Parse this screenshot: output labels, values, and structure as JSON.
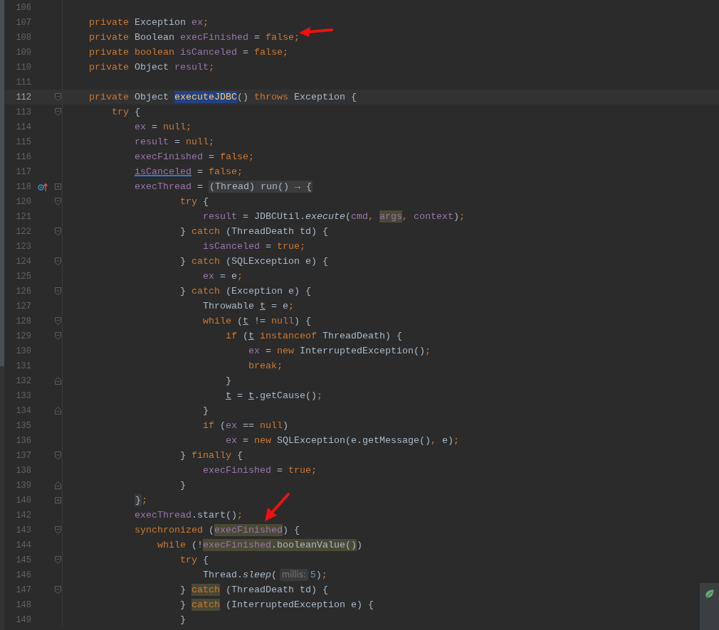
{
  "editor": {
    "lines": [
      {
        "number": "106",
        "current": false
      },
      {
        "number": "107",
        "current": false,
        "tokens": [
          {
            "kind": "keyword",
            "text": "    private "
          },
          {
            "kind": "plain",
            "text": "Exception "
          },
          {
            "kind": "field",
            "text": "ex"
          },
          {
            "kind": "keyword",
            "text": ";"
          }
        ]
      },
      {
        "number": "108",
        "current": false,
        "tokens": [
          {
            "kind": "keyword",
            "text": "    private "
          },
          {
            "kind": "plain",
            "text": "Boolean "
          },
          {
            "kind": "field",
            "text": "execFinished"
          },
          {
            "kind": "plain",
            "text": " = "
          },
          {
            "kind": "keyword",
            "text": "false;"
          }
        ]
      },
      {
        "number": "109",
        "current": false,
        "tokens": [
          {
            "kind": "keyword",
            "text": "    private boolean "
          },
          {
            "kind": "field",
            "text": "isCanceled"
          },
          {
            "kind": "plain",
            "text": " = "
          },
          {
            "kind": "keyword",
            "text": "false;"
          }
        ]
      },
      {
        "number": "110",
        "current": false,
        "tokens": [
          {
            "kind": "keyword",
            "text": "    private "
          },
          {
            "kind": "plain",
            "text": "Object "
          },
          {
            "kind": "field",
            "text": "result"
          },
          {
            "kind": "keyword",
            "text": ";"
          }
        ]
      },
      {
        "number": "111",
        "current": false
      },
      {
        "number": "112",
        "current": true,
        "fold": {
          "kind": "start"
        },
        "tokens": [
          {
            "kind": "keyword",
            "text": "    private "
          },
          {
            "kind": "plain",
            "text": "Object "
          },
          {
            "kind": "declaration",
            "text": "executeJDBC",
            "highlight": {
              "kind": "selected"
            }
          },
          {
            "kind": "plain",
            "text": "() "
          },
          {
            "kind": "keyword",
            "text": "throws "
          },
          {
            "kind": "plain",
            "text": "Exception {"
          }
        ]
      },
      {
        "number": "113",
        "current": false,
        "fold": {
          "kind": "start"
        },
        "tokens": [
          {
            "kind": "keyword",
            "text": "        try "
          },
          {
            "kind": "plain",
            "text": "{"
          }
        ]
      },
      {
        "number": "114",
        "current": false,
        "tokens": [
          {
            "kind": "field",
            "text": "            ex"
          },
          {
            "kind": "plain",
            "text": " = "
          },
          {
            "kind": "keyword",
            "text": "null;"
          }
        ]
      },
      {
        "number": "115",
        "current": false,
        "tokens": [
          {
            "kind": "field",
            "text": "            result"
          },
          {
            "kind": "plain",
            "text": " = "
          },
          {
            "kind": "keyword",
            "text": "null;"
          }
        ]
      },
      {
        "number": "116",
        "current": false,
        "tokens": [
          {
            "kind": "field",
            "text": "            execFinished"
          },
          {
            "kind": "plain",
            "text": " = "
          },
          {
            "kind": "keyword",
            "text": "false;"
          }
        ]
      },
      {
        "number": "117",
        "current": false,
        "tokens": [
          {
            "kind": "field",
            "text": "            isCanceled",
            "highlight": {
              "kind": "link"
            }
          },
          {
            "kind": "plain",
            "text": " = "
          },
          {
            "kind": "keyword",
            "text": "false;"
          }
        ]
      },
      {
        "number": "118",
        "current": false,
        "fold": {
          "kind": "plus"
        },
        "gutter_icon": {
          "kind": "override"
        },
        "tokens": [
          {
            "kind": "field",
            "text": "            execThread"
          },
          {
            "kind": "plain",
            "text": " = "
          },
          {
            "kind": "folded",
            "text": "(Thread) run() → {"
          }
        ]
      },
      {
        "number": "120",
        "current": false,
        "fold": {
          "kind": "start"
        },
        "tokens": [
          {
            "kind": "keyword",
            "text": "                    try "
          },
          {
            "kind": "plain",
            "text": "{"
          }
        ]
      },
      {
        "number": "121",
        "current": false,
        "tokens": [
          {
            "kind": "field",
            "text": "                        result"
          },
          {
            "kind": "plain",
            "text": " = JDBCUtil."
          },
          {
            "kind": "method",
            "text": "execute"
          },
          {
            "kind": "plain",
            "text": "("
          },
          {
            "kind": "field",
            "text": "cmd"
          },
          {
            "kind": "keyword",
            "text": ", "
          },
          {
            "kind": "field",
            "text": "args",
            "highlight": {
              "kind": "usage"
            }
          },
          {
            "kind": "keyword",
            "text": ", "
          },
          {
            "kind": "field",
            "text": "context"
          },
          {
            "kind": "plain",
            "text": ")"
          },
          {
            "kind": "keyword",
            "text": ";"
          }
        ]
      },
      {
        "number": "122",
        "current": false,
        "fold": {
          "kind": "mid"
        },
        "tokens": [
          {
            "kind": "plain",
            "text": "                    } "
          },
          {
            "kind": "keyword",
            "text": "catch "
          },
          {
            "kind": "plain",
            "text": "(ThreadDeath td) {"
          }
        ]
      },
      {
        "number": "123",
        "current": false,
        "tokens": [
          {
            "kind": "field",
            "text": "                        isCanceled"
          },
          {
            "kind": "plain",
            "text": " = "
          },
          {
            "kind": "keyword",
            "text": "true;"
          }
        ]
      },
      {
        "number": "124",
        "current": false,
        "fold": {
          "kind": "mid"
        },
        "tokens": [
          {
            "kind": "plain",
            "text": "                    } "
          },
          {
            "kind": "keyword",
            "text": "catch "
          },
          {
            "kind": "plain",
            "text": "(SQLException e) {"
          }
        ]
      },
      {
        "number": "125",
        "current": false,
        "tokens": [
          {
            "kind": "field",
            "text": "                        ex"
          },
          {
            "kind": "plain",
            "text": " = e"
          },
          {
            "kind": "keyword",
            "text": ";"
          }
        ]
      },
      {
        "number": "126",
        "current": false,
        "fold": {
          "kind": "mid"
        },
        "tokens": [
          {
            "kind": "plain",
            "text": "                    } "
          },
          {
            "kind": "keyword",
            "text": "catch "
          },
          {
            "kind": "plain",
            "text": "(Exception e) {"
          }
        ]
      },
      {
        "number": "127",
        "current": false,
        "tokens": [
          {
            "kind": "plain",
            "text": "                        Throwable "
          },
          {
            "kind": "plain",
            "text": "t",
            "highlight": {
              "kind": "underline"
            }
          },
          {
            "kind": "plain",
            "text": " = e"
          },
          {
            "kind": "keyword",
            "text": ";"
          }
        ]
      },
      {
        "number": "128",
        "current": false,
        "fold": {
          "kind": "start"
        },
        "tokens": [
          {
            "kind": "keyword",
            "text": "                        while "
          },
          {
            "kind": "plain",
            "text": "("
          },
          {
            "kind": "plain",
            "text": "t",
            "highlight": {
              "kind": "underline"
            }
          },
          {
            "kind": "plain",
            "text": " != "
          },
          {
            "kind": "keyword",
            "text": "null"
          },
          {
            "kind": "plain",
            "text": ") {"
          }
        ]
      },
      {
        "number": "129",
        "current": false,
        "fold": {
          "kind": "start"
        },
        "tokens": [
          {
            "kind": "keyword",
            "text": "                            if "
          },
          {
            "kind": "plain",
            "text": "("
          },
          {
            "kind": "plain",
            "text": "t",
            "highlight": {
              "kind": "underline"
            }
          },
          {
            "kind": "keyword",
            "text": " instanceof "
          },
          {
            "kind": "plain",
            "text": "ThreadDeath) {"
          }
        ]
      },
      {
        "number": "130",
        "current": false,
        "tokens": [
          {
            "kind": "field",
            "text": "                                ex"
          },
          {
            "kind": "plain",
            "text": " = "
          },
          {
            "kind": "keyword",
            "text": "new "
          },
          {
            "kind": "plain",
            "text": "InterruptedException()"
          },
          {
            "kind": "keyword",
            "text": ";"
          }
        ]
      },
      {
        "number": "131",
        "current": false,
        "tokens": [
          {
            "kind": "keyword",
            "text": "                                break;"
          }
        ]
      },
      {
        "number": "132",
        "current": false,
        "fold": {
          "kind": "end"
        },
        "tokens": [
          {
            "kind": "plain",
            "text": "                            }"
          }
        ]
      },
      {
        "number": "133",
        "current": false,
        "tokens": [
          {
            "kind": "plain",
            "text": "                            t",
            "highlight": {
              "kind": "underline"
            }
          },
          {
            "kind": "plain",
            "text": " = "
          },
          {
            "kind": "plain",
            "text": "t",
            "highlight": {
              "kind": "underline"
            }
          },
          {
            "kind": "plain",
            "text": ".getCause()"
          },
          {
            "kind": "keyword",
            "text": ";"
          }
        ]
      },
      {
        "number": "134",
        "current": false,
        "fold": {
          "kind": "end"
        },
        "tokens": [
          {
            "kind": "plain",
            "text": "                        }"
          }
        ]
      },
      {
        "number": "135",
        "current": false,
        "tokens": [
          {
            "kind": "keyword",
            "text": "                        if "
          },
          {
            "kind": "plain",
            "text": "("
          },
          {
            "kind": "field",
            "text": "ex"
          },
          {
            "kind": "plain",
            "text": " == "
          },
          {
            "kind": "keyword",
            "text": "null"
          },
          {
            "kind": "plain",
            "text": ")"
          }
        ]
      },
      {
        "number": "136",
        "current": false,
        "tokens": [
          {
            "kind": "field",
            "text": "                            ex"
          },
          {
            "kind": "plain",
            "text": " = "
          },
          {
            "kind": "keyword",
            "text": "new "
          },
          {
            "kind": "plain",
            "text": "SQLException(e.getMessage()"
          },
          {
            "kind": "keyword",
            "text": ", "
          },
          {
            "kind": "plain",
            "text": "e)"
          },
          {
            "kind": "keyword",
            "text": ";"
          }
        ]
      },
      {
        "number": "137",
        "current": false,
        "fold": {
          "kind": "mid"
        },
        "tokens": [
          {
            "kind": "plain",
            "text": "                    } "
          },
          {
            "kind": "keyword",
            "text": "finally "
          },
          {
            "kind": "plain",
            "text": "{"
          }
        ]
      },
      {
        "number": "138",
        "current": false,
        "tokens": [
          {
            "kind": "field",
            "text": "                        execFinished"
          },
          {
            "kind": "plain",
            "text": " = "
          },
          {
            "kind": "keyword",
            "text": "true;"
          }
        ]
      },
      {
        "number": "139",
        "current": false,
        "fold": {
          "kind": "end"
        },
        "tokens": [
          {
            "kind": "plain",
            "text": "                    }"
          }
        ]
      },
      {
        "number": "140",
        "current": false,
        "fold": {
          "kind": "plus"
        },
        "tokens": [
          {
            "kind": "folded",
            "text": "            }"
          },
          {
            "kind": "keyword",
            "text": ";"
          }
        ]
      },
      {
        "number": "142",
        "current": false,
        "tokens": [
          {
            "kind": "field",
            "text": "            execThread"
          },
          {
            "kind": "plain",
            "text": ".start()"
          },
          {
            "kind": "keyword",
            "text": ";"
          }
        ]
      },
      {
        "number": "143",
        "current": false,
        "fold": {
          "kind": "start"
        },
        "tokens": [
          {
            "kind": "keyword",
            "text": "            synchronized "
          },
          {
            "kind": "plain",
            "text": "("
          },
          {
            "kind": "field",
            "text": "execFinished",
            "highlight": {
              "kind": "usage"
            }
          },
          {
            "kind": "plain",
            "text": ") {"
          }
        ]
      },
      {
        "number": "144",
        "current": false,
        "tokens": [
          {
            "kind": "keyword",
            "text": "                while "
          },
          {
            "kind": "plain",
            "text": "(!"
          },
          {
            "kind": "field",
            "text": "execFinished",
            "highlight": {
              "kind": "usage"
            }
          },
          {
            "kind": "plain",
            "text": ".booleanValue()",
            "highlight": {
              "kind": "usage"
            }
          },
          {
            "kind": "plain",
            "text": ")"
          }
        ]
      },
      {
        "number": "145",
        "current": false,
        "fold": {
          "kind": "start"
        },
        "tokens": [
          {
            "kind": "keyword",
            "text": "                    try "
          },
          {
            "kind": "plain",
            "text": "{"
          }
        ]
      },
      {
        "number": "146",
        "current": false,
        "tokens": [
          {
            "kind": "plain",
            "text": "                        Thread."
          },
          {
            "kind": "method",
            "text": "sleep"
          },
          {
            "kind": "plain",
            "text": "("
          },
          {
            "kind": "hint",
            "text": "millis:"
          },
          {
            "kind": "number",
            "text": "5"
          },
          {
            "kind": "plain",
            "text": ")"
          },
          {
            "kind": "keyword",
            "text": ";"
          }
        ]
      },
      {
        "number": "147",
        "current": false,
        "fold": {
          "kind": "mid"
        },
        "tokens": [
          {
            "kind": "plain",
            "text": "                    } "
          },
          {
            "kind": "keyword",
            "text": "catch",
            "highlight": {
              "kind": "usage"
            }
          },
          {
            "kind": "plain",
            "text": " (ThreadDeath td) {"
          }
        ]
      },
      {
        "number": "148",
        "current": false,
        "tokens": [
          {
            "kind": "plain",
            "text": "                    } "
          },
          {
            "kind": "keyword",
            "text": "catch",
            "highlight": {
              "kind": "usage"
            }
          },
          {
            "kind": "plain",
            "text": " (InterruptedException e) {"
          }
        ]
      },
      {
        "number": "149",
        "current": false,
        "tokens": [
          {
            "kind": "plain",
            "text": "                    }"
          }
        ]
      }
    ]
  }
}
